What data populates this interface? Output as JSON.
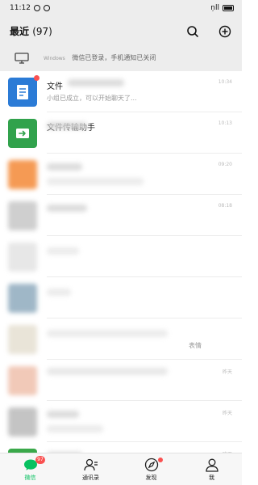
{
  "status_bar": {
    "time": "11:12",
    "signal": "ņll"
  },
  "header": {
    "title": "最近",
    "count": "(97)"
  },
  "banner": {
    "platform": "Windows",
    "text": "微信已登录，手机通知已关闭"
  },
  "chats": [
    {
      "title": "文件",
      "preview": "小组已成立，可以开始聊天了...",
      "time": "10:34",
      "avatar_color": "#2b7bd6",
      "badge": true
    },
    {
      "title": "文件传输助手",
      "preview": "",
      "time": "10:13",
      "avatar_color": "#31a24c",
      "badge": false
    },
    {
      "title": "",
      "preview": "",
      "time": "09:20",
      "avatar_color": "#f59a54",
      "badge": false
    },
    {
      "title": "",
      "preview": "",
      "time": "08:18",
      "avatar_color": "#cfcfcf",
      "badge": false
    },
    {
      "title": "",
      "preview": "",
      "time": "",
      "avatar_color": "#e7e7e7",
      "badge": false
    },
    {
      "title": "",
      "preview": "",
      "time": "",
      "avatar_color": "#9fb7c7",
      "badge": false
    },
    {
      "title": "",
      "preview": "表情",
      "time": "",
      "avatar_color": "#e9e4d8",
      "badge": false
    },
    {
      "title": "",
      "preview": "",
      "time": "昨天",
      "avatar_color": "#f1c9b8",
      "badge": false
    },
    {
      "title": "",
      "preview": "",
      "time": "昨天",
      "avatar_color": "#c4c4c4",
      "badge": false
    },
    {
      "title": "",
      "preview": "",
      "time": "昨天",
      "avatar_color": "#3aa84a",
      "badge": false
    }
  ],
  "tabbar": {
    "chats": {
      "label": "微信",
      "badge": "97"
    },
    "contacts": {
      "label": "通讯录"
    },
    "discover": {
      "label": "发现"
    },
    "me": {
      "label": "我"
    }
  },
  "colors": {
    "accent": "#07c160",
    "badge": "#fa5151",
    "background": "#ededed"
  }
}
